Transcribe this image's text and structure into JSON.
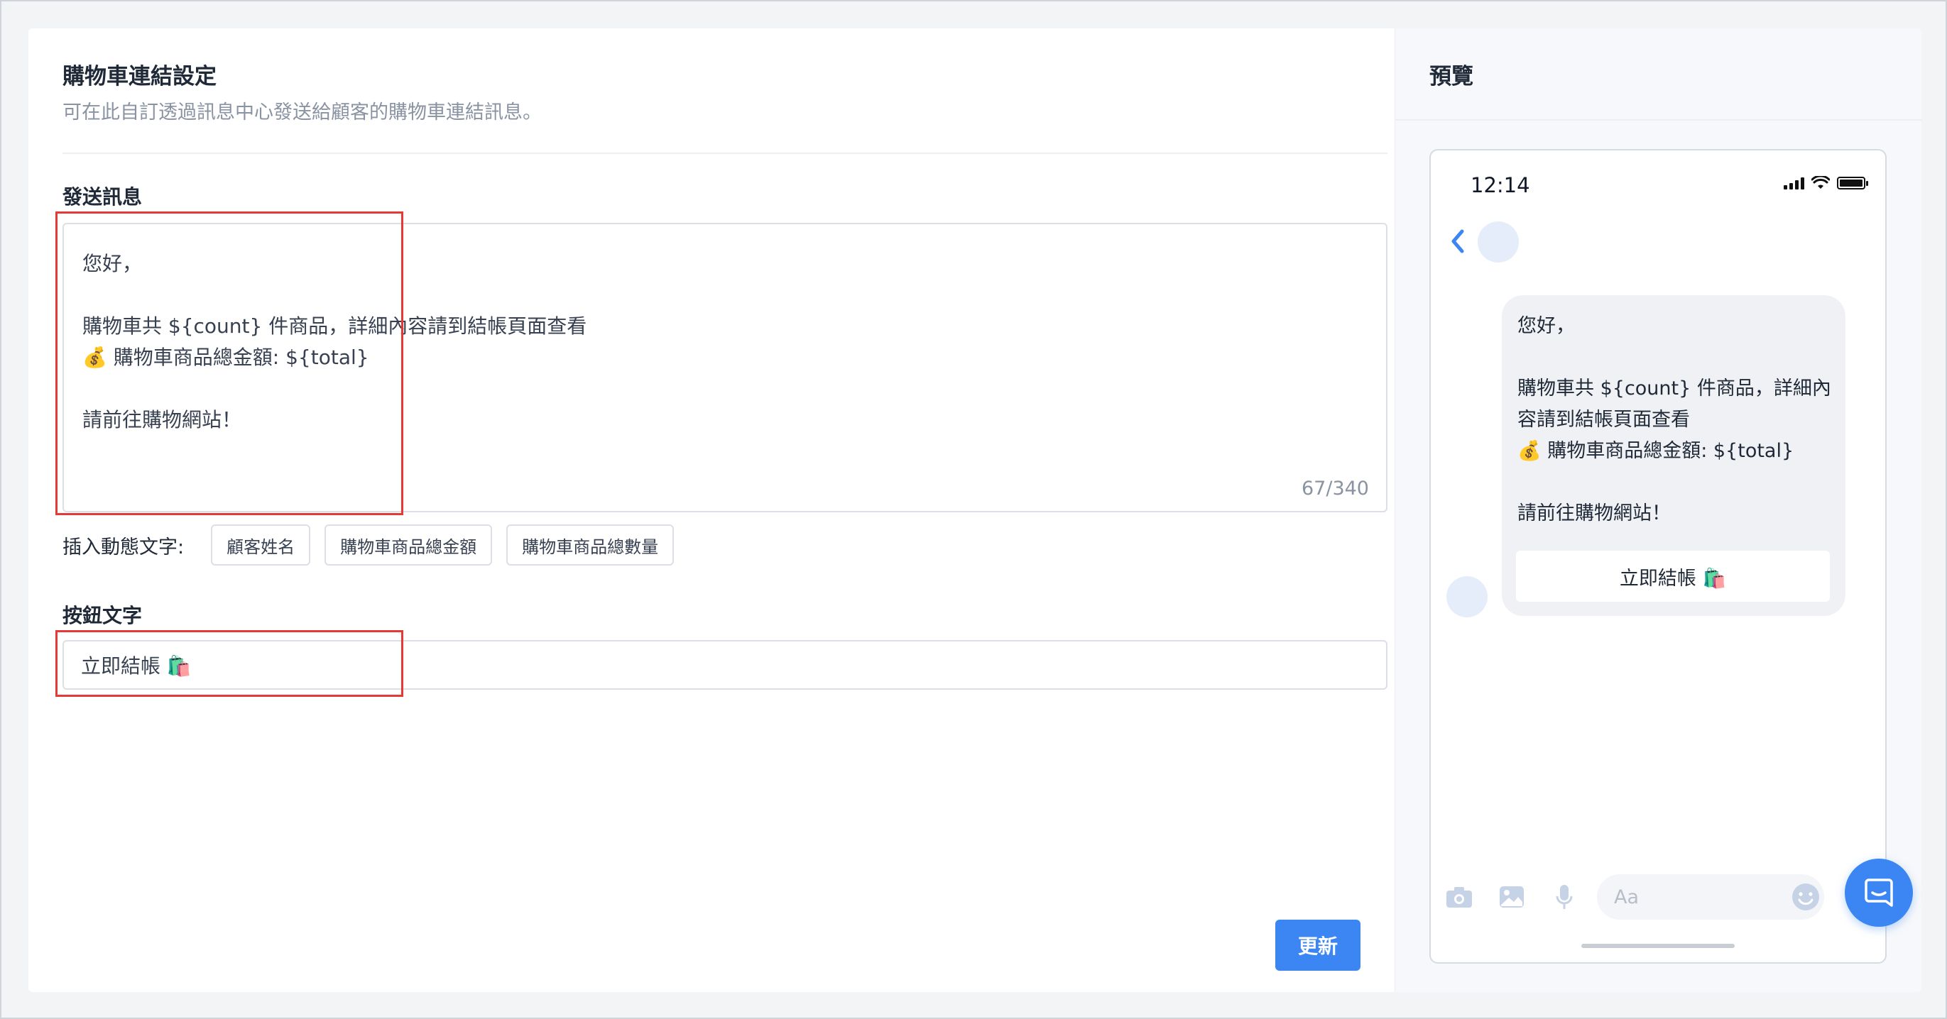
{
  "settings": {
    "title": "購物車連結設定",
    "description": "可在此自訂透過訊息中心發送給顧客的購物車連結訊息。",
    "message_label": "發送訊息",
    "message_lines": [
      "您好，",
      "",
      "購物車共 ${count} 件商品，詳細內容請到結帳頁面查看",
      "💰 購物車商品總金額: ${total}",
      "",
      "請前往購物網站！"
    ],
    "char_counter": "67/340",
    "insert_label": "插入動態文字:",
    "insert_chips": [
      "顧客姓名",
      "購物車商品總金額",
      "購物車商品總數量"
    ],
    "button_text_label": "按鈕文字",
    "button_text_value": "立即結帳 🛍️",
    "update_button": "更新"
  },
  "preview": {
    "title": "預覽",
    "status_time": "12:14",
    "bubble_lines": [
      "您好，",
      "",
      "購物車共 ${count} 件商品，詳細內容請到結帳頁面查看",
      "💰 購物車商品總金額: ${total}",
      "",
      "請前往購物網站！"
    ],
    "bubble_button": "立即結帳 🛍️",
    "composer_placeholder": "Aa"
  },
  "colors": {
    "accent": "#3b86f2",
    "highlight": "#e53935"
  },
  "icons": [
    "signal-icon",
    "wifi-icon",
    "battery-icon",
    "back-chevron-icon",
    "camera-icon",
    "image-icon",
    "microphone-icon",
    "emoji-icon",
    "chat-icon"
  ]
}
